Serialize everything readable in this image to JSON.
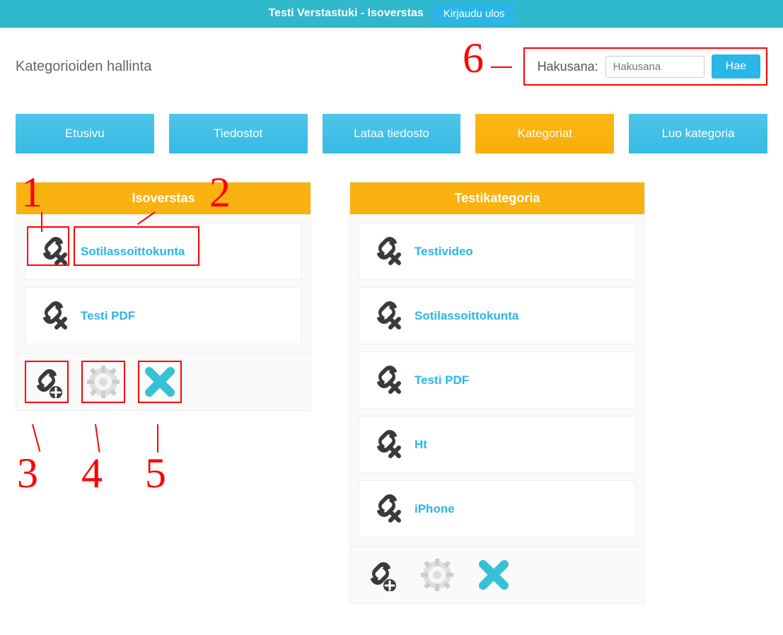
{
  "header": {
    "title": "Testi Verstastuki - Isoverstas",
    "logout": "Kirjaudu ulos"
  },
  "page_title": "Kategorioiden hallinta",
  "search": {
    "label": "Hakusana:",
    "placeholder": "Hakusana",
    "button": "Hae"
  },
  "nav": {
    "etusivu": "Etusivu",
    "tiedostot": "Tiedostot",
    "lataa": "Lataa tiedosto",
    "kategoriat": "Kategoriat",
    "luo": "Luo kategoria"
  },
  "cards": [
    {
      "title": "Isoverstas",
      "items": [
        "Sotilassoittokunta",
        "Testi PDF"
      ]
    },
    {
      "title": "Testikategoria",
      "items": [
        "Testivideo",
        "Sotilassoittokunta",
        "Testi PDF",
        "Ht",
        "iPhone"
      ]
    }
  ],
  "annotations": {
    "n1": "1",
    "n2": "2",
    "n3": "3",
    "n4": "4",
    "n5": "5",
    "n6": "6"
  }
}
